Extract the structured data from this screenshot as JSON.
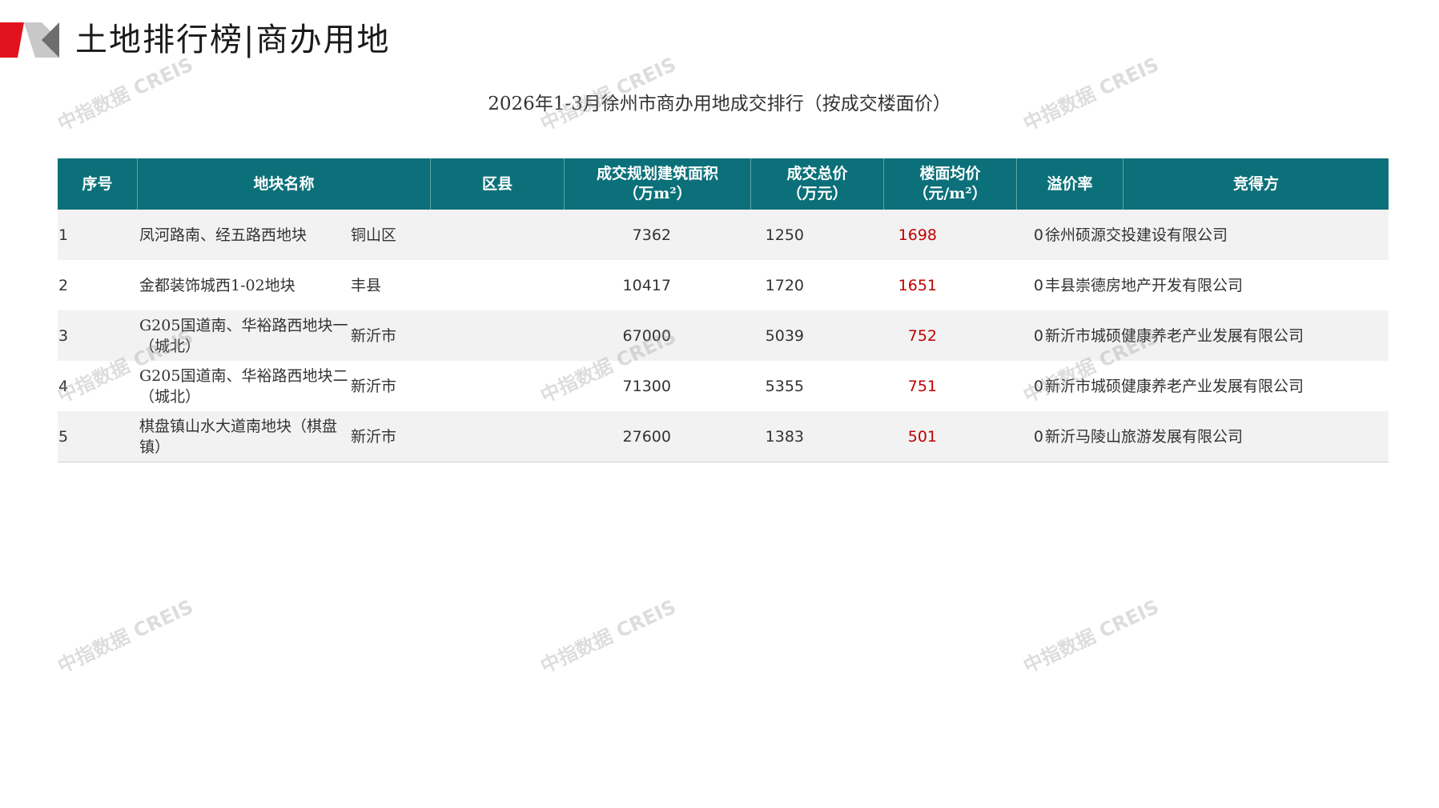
{
  "page": {
    "title": "土地排行榜|商办用地"
  },
  "table": {
    "title": "2026年1-3月徐州市商办用地成交排行（按成交楼面价）",
    "headers": {
      "no": "序号",
      "name": "地块名称",
      "district": "区县",
      "area": "成交规划建筑面积\n（万m²）",
      "total": "成交总价\n（万元）",
      "price": "楼面均价\n（元/m²）",
      "premium": "溢价率",
      "buyer": "竞得方"
    },
    "rows": [
      {
        "no": "1",
        "name": "凤河路南、经五路西地块",
        "district": "铜山区",
        "area": "7362",
        "total": "1250",
        "price": "1698",
        "premium": "0",
        "buyer": "徐州硕源交投建设有限公司"
      },
      {
        "no": "2",
        "name": "金都装饰城西1-02地块",
        "district": "丰县",
        "area": "10417",
        "total": "1720",
        "price": "1651",
        "premium": "0",
        "buyer": "丰县崇德房地产开发有限公司"
      },
      {
        "no": "3",
        "name": "G205国道南、华裕路西地块一（城北）",
        "district": "新沂市",
        "area": "67000",
        "total": "5039",
        "price": "752",
        "premium": "0",
        "buyer": "新沂市城硕健康养老产业发展有限公司"
      },
      {
        "no": "4",
        "name": "G205国道南、华裕路西地块二（城北）",
        "district": "新沂市",
        "area": "71300",
        "total": "5355",
        "price": "751",
        "premium": "0",
        "buyer": "新沂市城硕健康养老产业发展有限公司"
      },
      {
        "no": "5",
        "name": "棋盘镇山水大道南地块（棋盘镇）",
        "district": "新沂市",
        "area": "27600",
        "total": "1383",
        "price": "501",
        "premium": "0",
        "buyer": "新沂马陵山旅游发展有限公司"
      }
    ]
  },
  "watermark": {
    "text": "中指数据 CREIS"
  },
  "colors": {
    "header_bg": "#0b7079",
    "price_text": "#c00000",
    "logo_red": "#e2131d",
    "logo_gray": "#bfbfbf"
  }
}
